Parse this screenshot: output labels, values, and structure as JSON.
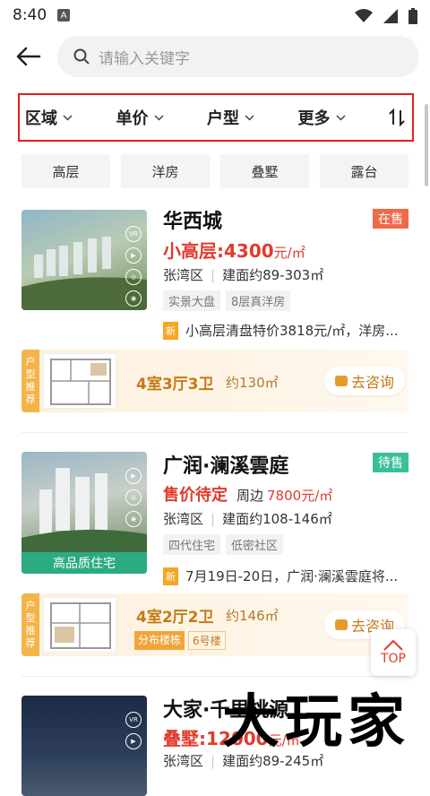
{
  "status": {
    "time": "8:40",
    "a_label": "A"
  },
  "search": {
    "placeholder": "请输入关键字"
  },
  "filters": [
    "区域",
    "单价",
    "户型",
    "更多"
  ],
  "chips": [
    "高层",
    "洋房",
    "叠墅",
    "露台"
  ],
  "listings": [
    {
      "name": "华西城",
      "badge": "在售",
      "badge_color": "#ef6a4a",
      "price": "小高层:4300",
      "price_unit": "元/㎡",
      "district": "张湾区",
      "area": "建面约89-303㎡",
      "tags": [
        "实景大盘",
        "8层真洋房"
      ],
      "news": "小高层清盘特价3818元/㎡，洋房...",
      "layout": "4室3厅3卫",
      "layout_size": "约130㎡"
    },
    {
      "name": "广润·澜溪雲庭",
      "badge": "待售",
      "badge_color": "#3bbf9a",
      "price": "售价待定",
      "price_note": "周边",
      "price_around": "7800元/㎡",
      "district": "张湾区",
      "area": "建面约108-146㎡",
      "tags": [
        "四代住宅",
        "低密社区"
      ],
      "news": "7月19日-20日，广润·澜溪雲庭将...",
      "thumb_label": "高品质住宅",
      "layout": "4室2厅2卫",
      "layout_size": "约146㎡",
      "layout_tag1": "分布楼栋",
      "layout_tag2": "6号楼"
    },
    {
      "name": "大家·千里桃源",
      "price": "叠墅:12000",
      "price_unit": "元/㎡",
      "district": "张湾区",
      "area": "建面约89-245㎡"
    }
  ],
  "layout_side_label": "户型推荐",
  "consult_label": "去咨询",
  "top_label": "TOP",
  "watermark": "大玩家",
  "colors": {
    "accent": "#e23a2c",
    "filter_border": "#e02020"
  }
}
